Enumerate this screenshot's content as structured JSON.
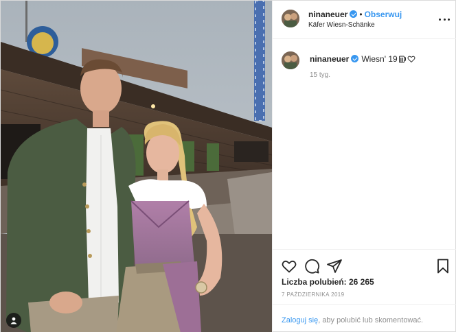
{
  "header": {
    "username": "ninaneuer",
    "separator": "•",
    "follow_label": "Obserwuj",
    "location": "Käfer Wiesn-Schänke"
  },
  "caption": {
    "username": "ninaneuer",
    "text": "Wiesn' 19",
    "relative_time": "15 tyg."
  },
  "stats": {
    "likes": "Liczba polubień: 26 265",
    "date": "7 PAŹDZIERNIKA 2019"
  },
  "login": {
    "link": "Zaloguj się",
    "text": ", aby polubić lub skomentować."
  },
  "icons": {
    "more": "more-options-icon",
    "like": "heart-icon",
    "comment": "comment-icon",
    "share": "share-icon",
    "save": "bookmark-icon",
    "user_tag": "user-tag-icon",
    "verified": "verified-badge-icon"
  },
  "colors": {
    "accent": "#3897f0",
    "text": "#262626",
    "muted": "#8e8e8e",
    "border": "#efefef"
  }
}
